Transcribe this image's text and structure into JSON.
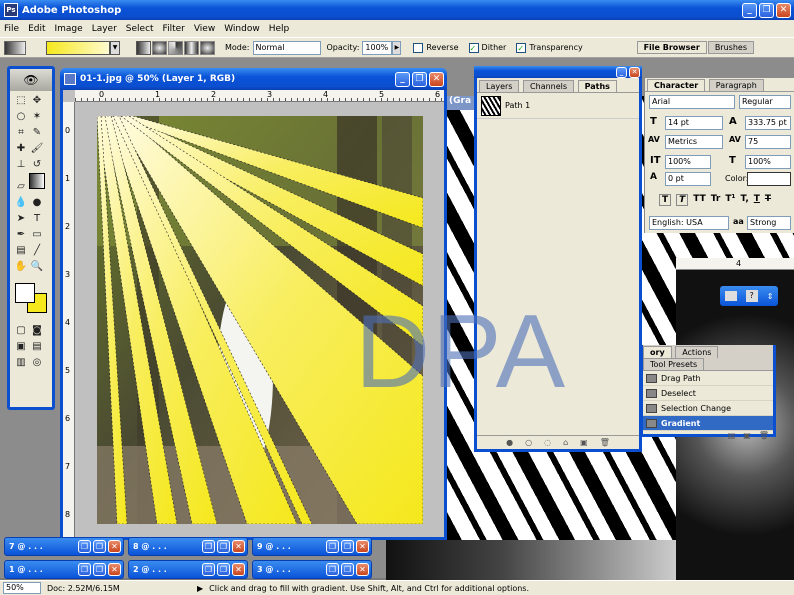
{
  "app": {
    "title": "Adobe Photoshop",
    "logo_label": "Ps"
  },
  "window_controls": {
    "min": "_",
    "max": "❐",
    "close": "✕"
  },
  "menu": [
    "File",
    "Edit",
    "Image",
    "Layer",
    "Select",
    "Filter",
    "View",
    "Window",
    "Help"
  ],
  "options": {
    "mode_label": "Mode:",
    "mode_value": "Normal",
    "opacity_label": "Opacity:",
    "opacity_value": "100%",
    "reverse": "Reverse",
    "dither": "Dither",
    "transparency": "Transparency",
    "file_browser": "File Browser",
    "brushes": "Brushes"
  },
  "document": {
    "title": "01-1.jpg @ 50% (Layer 1, RGB)",
    "zoom": "50%",
    "doc_size": "Doc: 2.52M/6.15M"
  },
  "ruler": {
    "top": [
      "0",
      "1",
      "2",
      "3",
      "4",
      "5",
      "6"
    ],
    "left": [
      "0",
      "1",
      "2",
      "3",
      "4",
      "5",
      "6",
      "7",
      "8"
    ]
  },
  "bg_doc": {
    "title_fragment": "(Gra",
    "ruler_mark": "4"
  },
  "watermark": "DPA",
  "layers_panel": {
    "tabs": [
      "Layers",
      "Channels",
      "Paths"
    ],
    "active": 2,
    "path_item": "Path 1"
  },
  "character_panel": {
    "tabs": [
      "Character",
      "Paragraph"
    ],
    "active": 0,
    "font": "Arial",
    "style": "Regular",
    "size": "14 pt",
    "leading": "333.75 pt",
    "kerning": "Metrics",
    "tracking": "75",
    "vscale": "100%",
    "hscale": "100%",
    "baseline": "0 pt",
    "color_label": "Color:",
    "language": "English: USA",
    "aa": "Strong",
    "aa_label": "aa",
    "style_buttons": [
      "T",
      "T",
      "TT",
      "Tr",
      "T¹",
      "T,",
      "T",
      "T"
    ]
  },
  "history_panel": {
    "tabs": [
      "ory",
      "Actions",
      "Tool Presets"
    ],
    "items": [
      "Drag Path",
      "Deselect",
      "Selection Change",
      "Gradient"
    ],
    "selected": 3
  },
  "minimized": [
    {
      "label": "7 @ . . ."
    },
    {
      "label": "8 @ . . ."
    },
    {
      "label": "9 @ . . ."
    },
    {
      "label": "1 @ . . ."
    },
    {
      "label": "2 @ . . ."
    },
    {
      "label": "3 @ . . ."
    }
  ],
  "status": {
    "zoom": "50%",
    "doc": "Doc: 2.52M/6.15M",
    "hint": "Click and drag to fill with gradient. Use Shift, Alt, and Ctrl for additional options."
  },
  "colors": {
    "title_blue": "#0a53d8",
    "panel": "#ece9d8",
    "select_blue": "#316ac5",
    "gradient_yellow": "#f5e81c"
  }
}
